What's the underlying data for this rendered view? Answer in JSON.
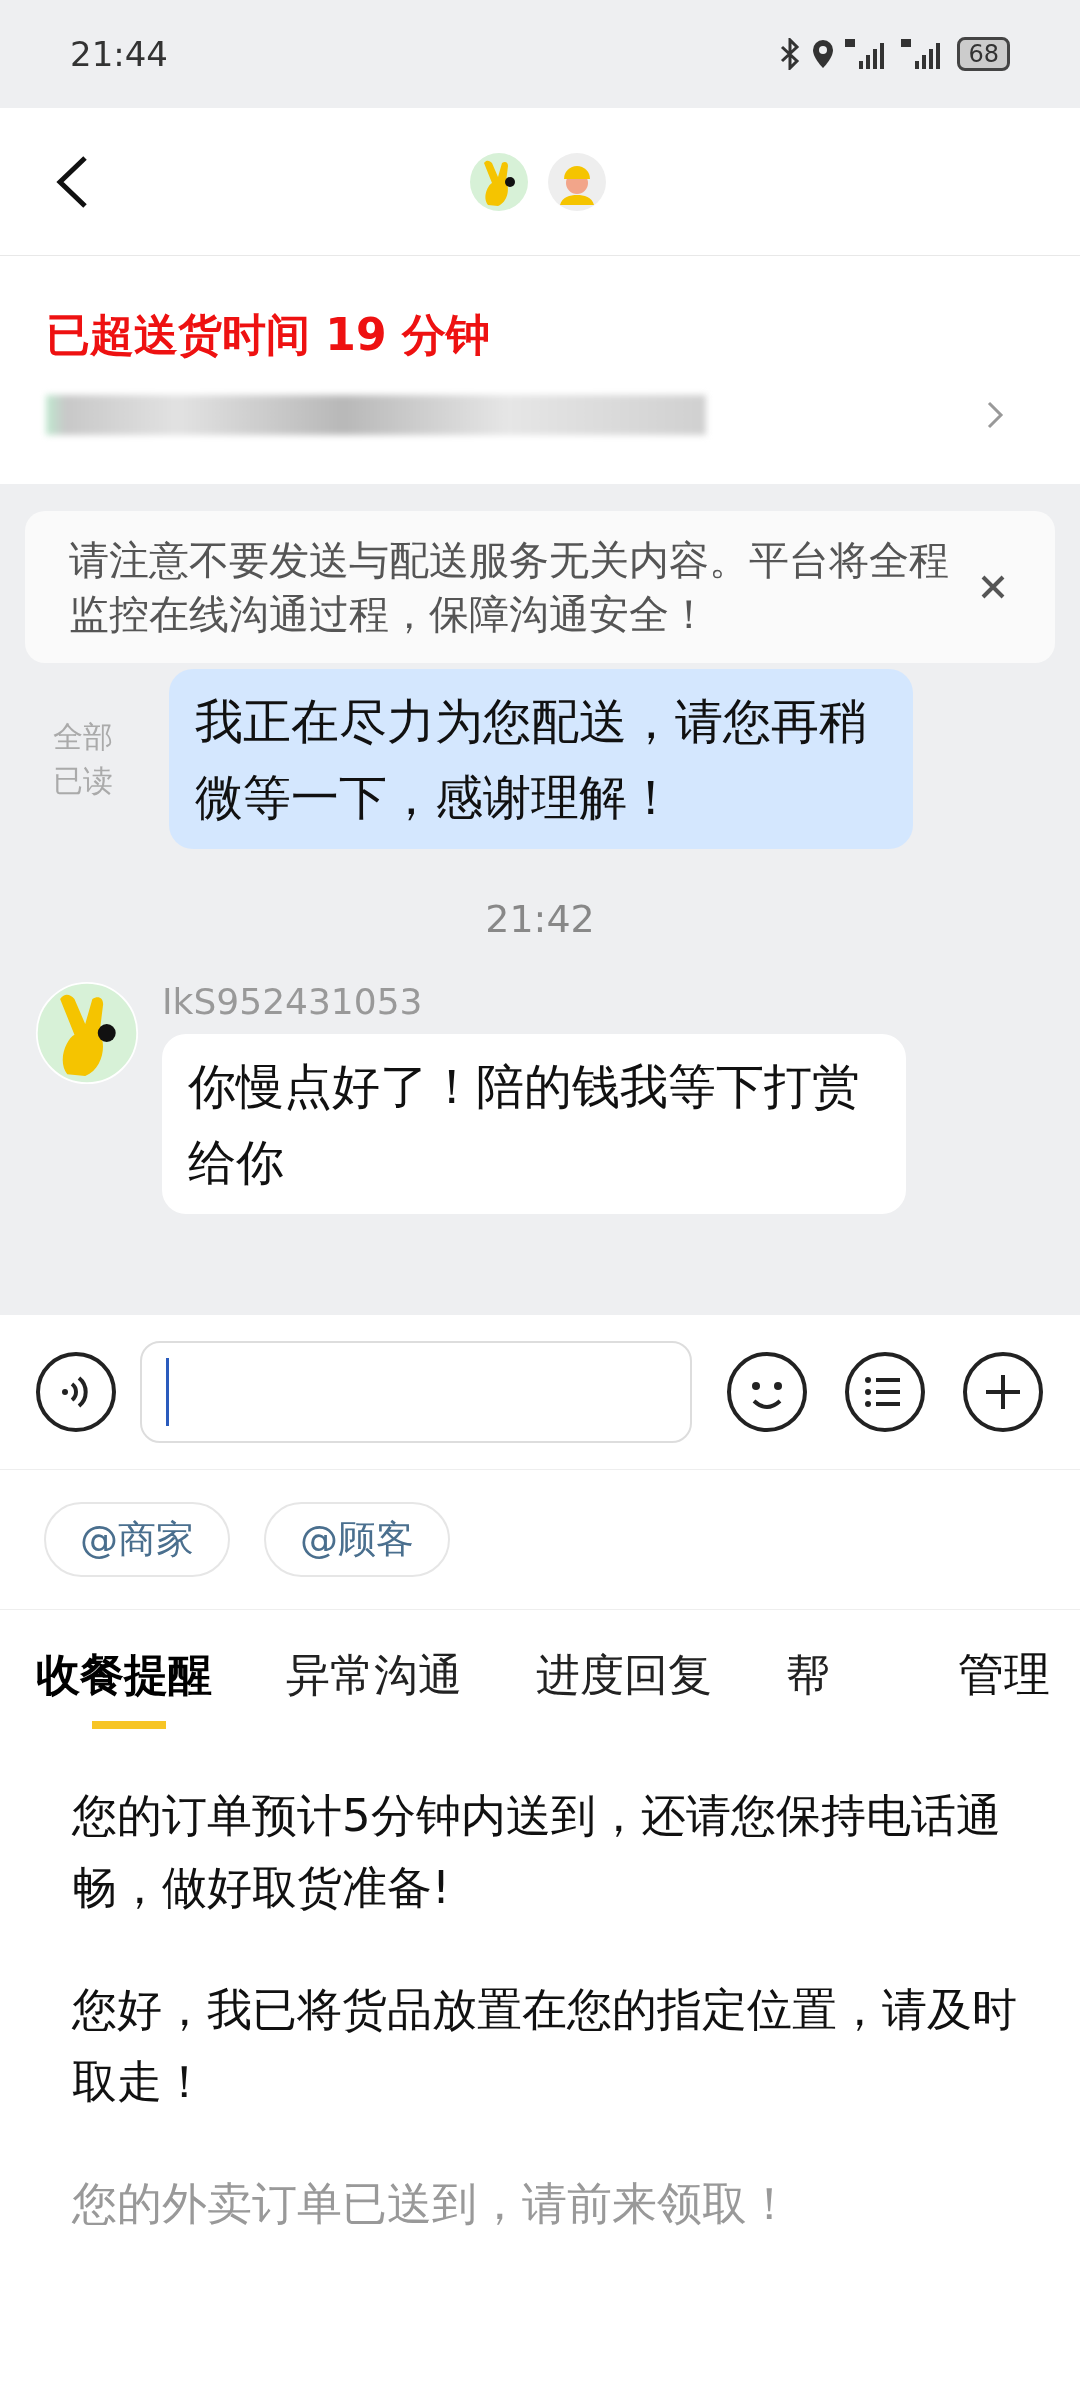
{
  "status_bar": {
    "time": "21:44",
    "battery": "68"
  },
  "order": {
    "overdue": "已超送货时间 19 分钟"
  },
  "notice": {
    "text": "请注意不要发送与配送服务无关内容。平台将全程监控在线沟通过程，保障沟通安全！"
  },
  "messages": [
    {
      "kind": "outgoing",
      "read_status": "全部已读",
      "text": "我正在尽力为您配送，请您再稍微等一下，感谢理解！"
    },
    {
      "kind": "time",
      "text": "21:42"
    },
    {
      "kind": "incoming",
      "sender": "IkS952431053",
      "text": "你慢点好了！陪的钱我等下打赏给你"
    }
  ],
  "mentions": [
    "@商家",
    "@顾客"
  ],
  "tabs": [
    {
      "label": "收餐提醒",
      "selected": true
    },
    {
      "label": "异常沟通",
      "selected": false
    },
    {
      "label": "进度回复",
      "selected": false
    },
    {
      "label": "帮",
      "selected": false
    }
  ],
  "manage_button": "管理",
  "quick_replies": [
    {
      "text": "您的订单预计5分钟内送到，还请您保持电话通畅，做好取货准备!",
      "faded": false
    },
    {
      "text": "您好，我已将货品放置在您的指定位置，请及时取走！",
      "faded": false
    },
    {
      "text": "您的外卖订单已送到，请前来领取！",
      "faded": true
    }
  ]
}
